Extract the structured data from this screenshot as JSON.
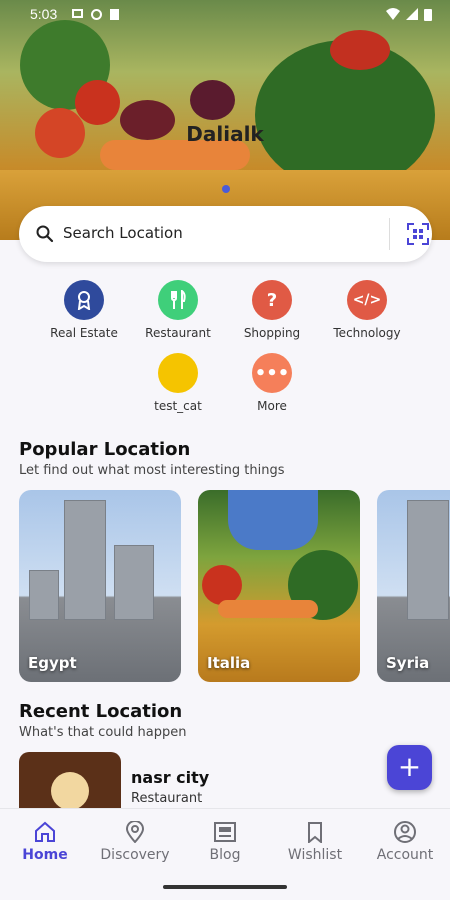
{
  "status_bar": {
    "time": "5:03"
  },
  "hero": {
    "title": "Dalialk"
  },
  "search": {
    "placeholder": "Search Location"
  },
  "categories": [
    {
      "label": "Real Estate",
      "color": "#2f4a9c",
      "icon": "award-icon"
    },
    {
      "label": "Restaurant",
      "color": "#3fcf7a",
      "icon": "fork-knife-icon"
    },
    {
      "label": "Shopping",
      "color": "#e05a45",
      "icon": "question-icon"
    },
    {
      "label": "Technology",
      "color": "#e05a45",
      "icon": "code-icon"
    },
    {
      "label": "test_cat",
      "color": "#f5c400",
      "icon": ""
    },
    {
      "label": "More",
      "color": "#f57f5a",
      "icon": "more-icon"
    }
  ],
  "popular": {
    "title": "Popular Location",
    "subtitle": "Let find out what most interesting things",
    "items": [
      {
        "name": "Egypt"
      },
      {
        "name": "Italia"
      },
      {
        "name": "Syria"
      }
    ]
  },
  "recent": {
    "title": "Recent Location",
    "subtitle": "What's that could happen",
    "items": [
      {
        "name": "nasr city",
        "category": "Restaurant"
      }
    ]
  },
  "fab": {
    "label": "+"
  },
  "nav": {
    "items": [
      {
        "label": "Home",
        "icon": "home-icon",
        "active": true
      },
      {
        "label": "Discovery",
        "icon": "location-pin-icon"
      },
      {
        "label": "Blog",
        "icon": "article-icon"
      },
      {
        "label": "Wishlist",
        "icon": "bookmark-icon"
      },
      {
        "label": "Account",
        "icon": "account-icon"
      }
    ]
  },
  "colors": {
    "accent": "#4b45d6"
  }
}
